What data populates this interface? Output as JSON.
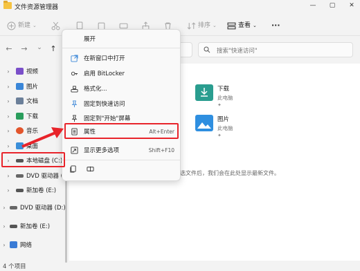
{
  "window": {
    "title": "文件资源管理器",
    "minimize": "—",
    "maximize": "▢",
    "close": "✕"
  },
  "toolbar": {
    "new_label": "新建",
    "sort_label": "排序",
    "view_label": "查看",
    "more_label": "···"
  },
  "navbar": {
    "back": "←",
    "forward": "→",
    "dropdown": "⌄",
    "up": "↑",
    "search_placeholder": "搜索\"快速访问\""
  },
  "sidebar": {
    "items": [
      {
        "label": "视频",
        "color": "#7a4fc9"
      },
      {
        "label": "图片",
        "color": "#3a86d8"
      },
      {
        "label": "文档",
        "color": "#6b7f99"
      },
      {
        "label": "下载",
        "color": "#2a9d5c"
      },
      {
        "label": "音乐",
        "color": "#e2552c"
      },
      {
        "label": "桌面",
        "color": "#3b8fd9"
      },
      {
        "label": "本地磁盘 (C:)",
        "color": "#555555"
      },
      {
        "label": "DVD 驱动器 (I",
        "color": "#666666"
      },
      {
        "label": "新加卷 (E:)",
        "color": "#555555"
      },
      {
        "label": "DVD 驱动器 (D:)",
        "color": "#666666"
      },
      {
        "label": "新加卷 (E:)",
        "color": "#555555"
      },
      {
        "label": "网络",
        "color": "#3a7bd5"
      }
    ]
  },
  "content": {
    "drives": [
      {
        "name": "下载",
        "sub": "此电脑",
        "pin": "✦",
        "color": "#2a9d8f"
      },
      {
        "name": "图片",
        "sub": "此电脑",
        "pin": "✦",
        "color": "#2f8fe0"
      }
    ],
    "empty_message": "选文件后，我们会在此处显示最新文件。"
  },
  "context_menu": {
    "items": [
      {
        "label": "展开",
        "shortcut": ""
      },
      {
        "label": "在新窗口中打开",
        "shortcut": ""
      },
      {
        "label": "启用 BitLocker",
        "shortcut": ""
      },
      {
        "label": "格式化...",
        "shortcut": ""
      },
      {
        "label": "固定到快速访问",
        "shortcut": ""
      },
      {
        "label": "固定到\"开始\"屏幕",
        "shortcut": ""
      },
      {
        "label": "属性",
        "shortcut": "Alt+Enter"
      },
      {
        "label": "显示更多选项",
        "shortcut": "Shift+F10"
      }
    ]
  },
  "status": {
    "item_count": "4 个项目"
  },
  "colors": {
    "highlight": "#e8232a",
    "accent": "#3a86d8"
  }
}
